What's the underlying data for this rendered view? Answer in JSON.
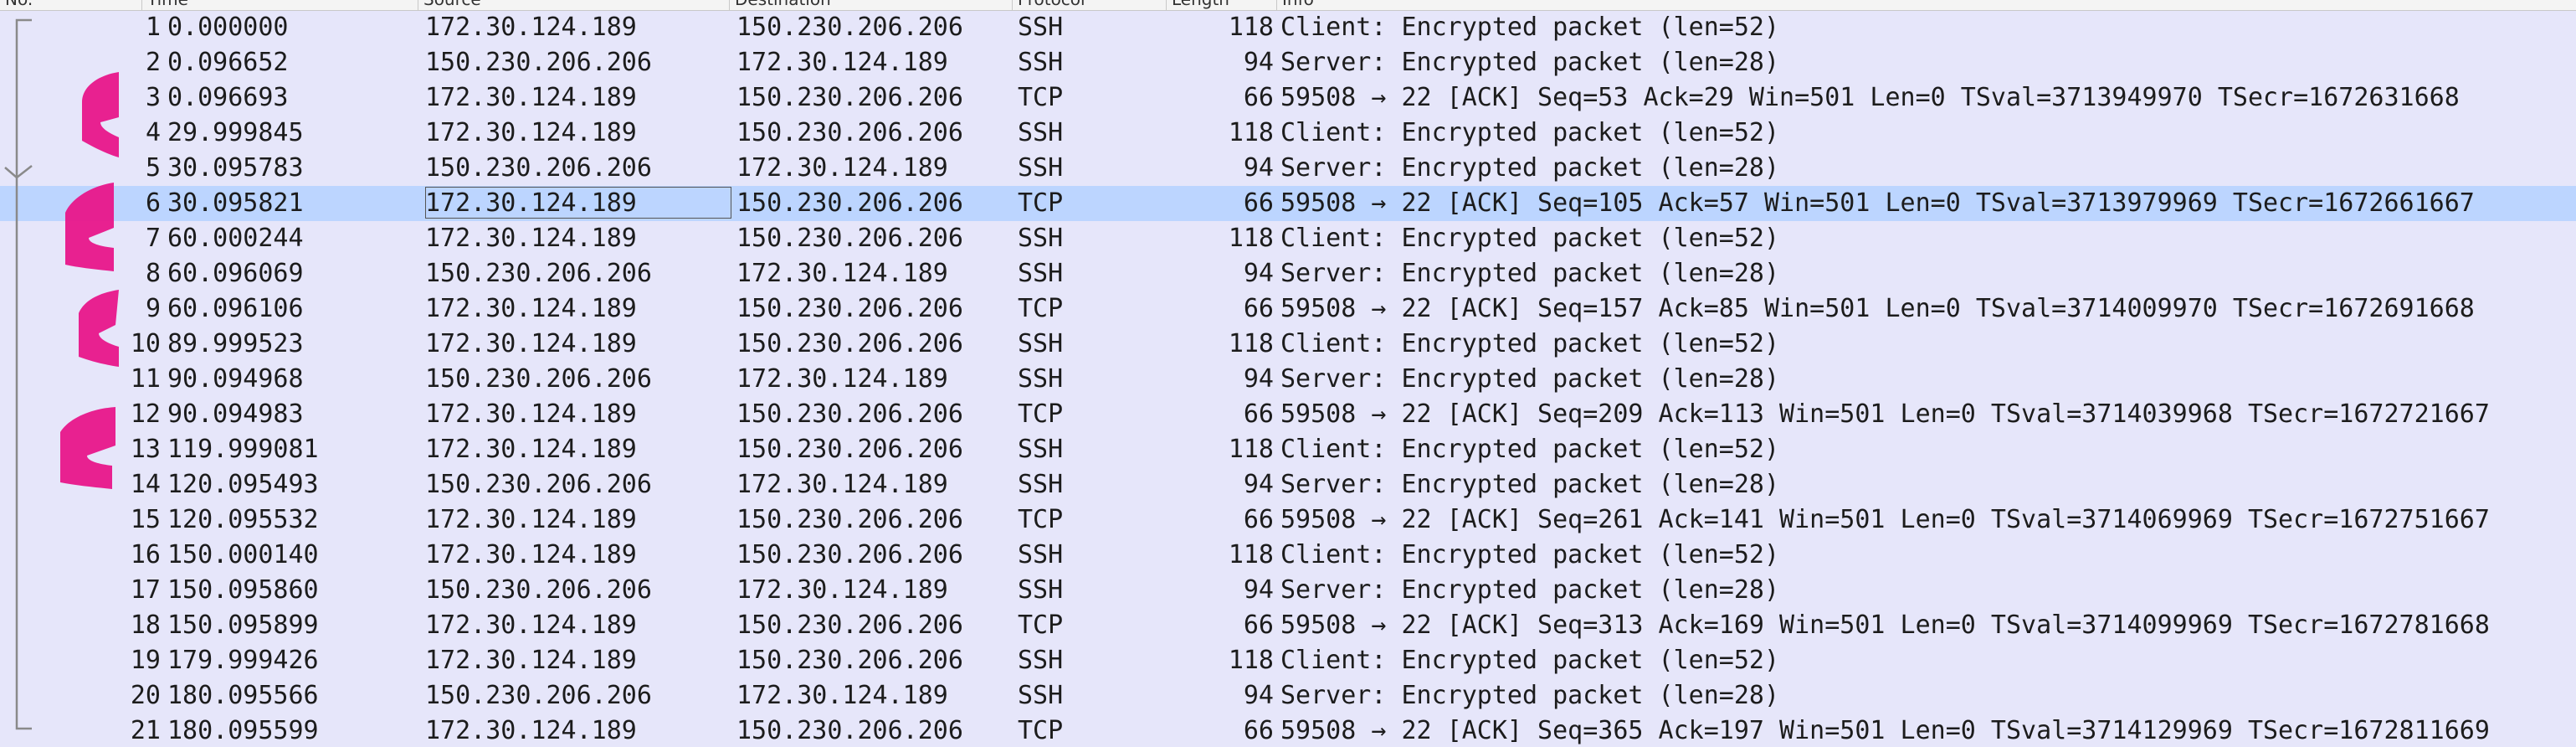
{
  "columns": {
    "no": "No.",
    "time": "Time",
    "source": "Source",
    "destination": "Destination",
    "protocol": "Protocol",
    "length": "Length",
    "info": "Info"
  },
  "selected_row": 6,
  "colors": {
    "row_background": "#e6e6fa",
    "selected_background": "#bcd5ff",
    "annotation": "#e8168a"
  },
  "packets": [
    {
      "no": "1",
      "time": "0.000000",
      "source": "172.30.124.189",
      "destination": "150.230.206.206",
      "protocol": "SSH",
      "length": "118",
      "info": "Client: Encrypted packet (len=52)"
    },
    {
      "no": "2",
      "time": "0.096652",
      "source": "150.230.206.206",
      "destination": "172.30.124.189",
      "protocol": "SSH",
      "length": "94",
      "info": "Server: Encrypted packet (len=28)"
    },
    {
      "no": "3",
      "time": "0.096693",
      "source": "172.30.124.189",
      "destination": "150.230.206.206",
      "protocol": "TCP",
      "length": "66",
      "info": "59508 → 22 [ACK] Seq=53 Ack=29 Win=501 Len=0 TSval=3713949970 TSecr=1672631668"
    },
    {
      "no": "4",
      "time": "29.999845",
      "source": "172.30.124.189",
      "destination": "150.230.206.206",
      "protocol": "SSH",
      "length": "118",
      "info": "Client: Encrypted packet (len=52)"
    },
    {
      "no": "5",
      "time": "30.095783",
      "source": "150.230.206.206",
      "destination": "172.30.124.189",
      "protocol": "SSH",
      "length": "94",
      "info": "Server: Encrypted packet (len=28)"
    },
    {
      "no": "6",
      "time": "30.095821",
      "source": "172.30.124.189",
      "destination": "150.230.206.206",
      "protocol": "TCP",
      "length": "66",
      "info": "59508 → 22 [ACK] Seq=105 Ack=57 Win=501 Len=0 TSval=3713979969 TSecr=1672661667"
    },
    {
      "no": "7",
      "time": "60.000244",
      "source": "172.30.124.189",
      "destination": "150.230.206.206",
      "protocol": "SSH",
      "length": "118",
      "info": "Client: Encrypted packet (len=52)"
    },
    {
      "no": "8",
      "time": "60.096069",
      "source": "150.230.206.206",
      "destination": "172.30.124.189",
      "protocol": "SSH",
      "length": "94",
      "info": "Server: Encrypted packet (len=28)"
    },
    {
      "no": "9",
      "time": "60.096106",
      "source": "172.30.124.189",
      "destination": "150.230.206.206",
      "protocol": "TCP",
      "length": "66",
      "info": "59508 → 22 [ACK] Seq=157 Ack=85 Win=501 Len=0 TSval=3714009970 TSecr=1672691668"
    },
    {
      "no": "10",
      "time": "89.999523",
      "source": "172.30.124.189",
      "destination": "150.230.206.206",
      "protocol": "SSH",
      "length": "118",
      "info": "Client: Encrypted packet (len=52)"
    },
    {
      "no": "11",
      "time": "90.094968",
      "source": "150.230.206.206",
      "destination": "172.30.124.189",
      "protocol": "SSH",
      "length": "94",
      "info": "Server: Encrypted packet (len=28)"
    },
    {
      "no": "12",
      "time": "90.094983",
      "source": "172.30.124.189",
      "destination": "150.230.206.206",
      "protocol": "TCP",
      "length": "66",
      "info": "59508 → 22 [ACK] Seq=209 Ack=113 Win=501 Len=0 TSval=3714039968 TSecr=1672721667"
    },
    {
      "no": "13",
      "time": "119.999081",
      "source": "172.30.124.189",
      "destination": "150.230.206.206",
      "protocol": "SSH",
      "length": "118",
      "info": "Client: Encrypted packet (len=52)"
    },
    {
      "no": "14",
      "time": "120.095493",
      "source": "150.230.206.206",
      "destination": "172.30.124.189",
      "protocol": "SSH",
      "length": "94",
      "info": "Server: Encrypted packet (len=28)"
    },
    {
      "no": "15",
      "time": "120.095532",
      "source": "172.30.124.189",
      "destination": "150.230.206.206",
      "protocol": "TCP",
      "length": "66",
      "info": "59508 → 22 [ACK] Seq=261 Ack=141 Win=501 Len=0 TSval=3714069969 TSecr=1672751667"
    },
    {
      "no": "16",
      "time": "150.000140",
      "source": "172.30.124.189",
      "destination": "150.230.206.206",
      "protocol": "SSH",
      "length": "118",
      "info": "Client: Encrypted packet (len=52)"
    },
    {
      "no": "17",
      "time": "150.095860",
      "source": "150.230.206.206",
      "destination": "172.30.124.189",
      "protocol": "SSH",
      "length": "94",
      "info": "Server: Encrypted packet (len=28)"
    },
    {
      "no": "18",
      "time": "150.095899",
      "source": "172.30.124.189",
      "destination": "150.230.206.206",
      "protocol": "TCP",
      "length": "66",
      "info": "59508 → 22 [ACK] Seq=313 Ack=169 Win=501 Len=0 TSval=3714099969 TSecr=1672781668"
    },
    {
      "no": "19",
      "time": "179.999426",
      "source": "172.30.124.189",
      "destination": "150.230.206.206",
      "protocol": "SSH",
      "length": "118",
      "info": "Client: Encrypted packet (len=52)"
    },
    {
      "no": "20",
      "time": "180.095566",
      "source": "150.230.206.206",
      "destination": "172.30.124.189",
      "protocol": "SSH",
      "length": "94",
      "info": "Server: Encrypted packet (len=28)"
    },
    {
      "no": "21",
      "time": "180.095599",
      "source": "172.30.124.189",
      "destination": "150.230.206.206",
      "protocol": "TCP",
      "length": "66",
      "info": "59508 → 22 [ACK] Seq=365 Ack=197 Win=501 Len=0 TSval=3714129969 TSecr=1672811669"
    }
  ]
}
